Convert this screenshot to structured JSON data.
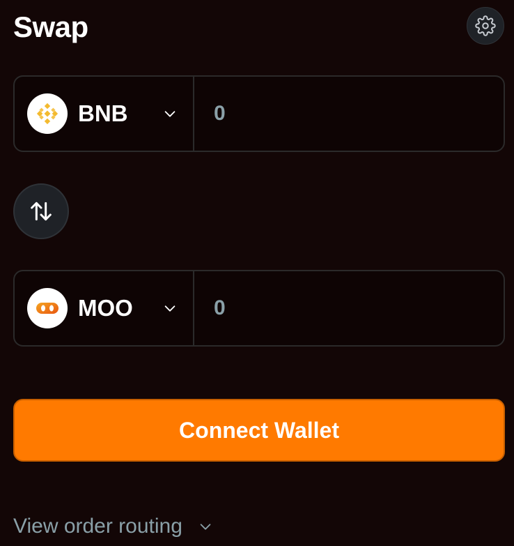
{
  "header": {
    "title": "Swap",
    "settings_icon": "gear-icon"
  },
  "from_token": {
    "symbol": "BNB",
    "logo_icon": "bnb-logo-icon",
    "amount_placeholder": "0",
    "dropdown_icon": "chevron-down-icon"
  },
  "switch_icon": "swap-arrows-icon",
  "to_token": {
    "symbol": "MOO",
    "logo_icon": "moo-logo-icon",
    "amount_placeholder": "0",
    "dropdown_icon": "chevron-down-icon"
  },
  "connect_button": {
    "label": "Connect Wallet"
  },
  "routing": {
    "label": "View order routing",
    "icon": "chevron-down-icon"
  },
  "colors": {
    "background": "#130606",
    "accent": "#ff7a00",
    "muted_text": "#8aa0a8",
    "bnb_yellow": "#f3ba2f",
    "moo_orange": "#f07c12"
  }
}
